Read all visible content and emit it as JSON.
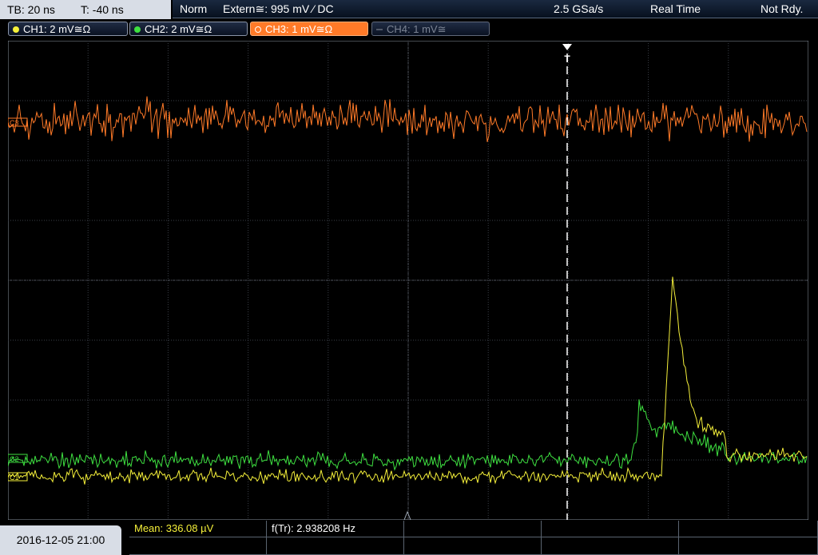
{
  "header": {
    "timebase": "TB: 20 ns",
    "trigger_time": "T: -40 ns",
    "trigger_mode": "Norm",
    "trigger_source": "Extern≅: 995 mV ⁄ DC",
    "sample_rate": "2.5 GSa/s",
    "acq_mode": "Real Time",
    "status": "Not Rdy."
  },
  "channels": [
    {
      "label": "CH1: 2 mV≅Ω",
      "color": "#f5f03a",
      "active": false,
      "enabled": true
    },
    {
      "label": "CH2: 2 mV≅Ω",
      "color": "#3ee040",
      "active": false,
      "enabled": true
    },
    {
      "label": "CH3: 1 mV≅Ω",
      "color": "#ff7a28",
      "active": true,
      "enabled": true
    },
    {
      "label": "CH4: 1 mV≅",
      "color": "#7c8494",
      "active": false,
      "enabled": false
    }
  ],
  "waveforms": {
    "ch3_marker": "C3",
    "ch2_marker": "C2",
    "ch1_marker": "C1",
    "trigger_marker": "T"
  },
  "footer": {
    "datetime": "2016-12-05 21:00",
    "mean": "Mean: 336.08 µV",
    "freq": "f(Tr): 2.938208 Hz"
  }
}
